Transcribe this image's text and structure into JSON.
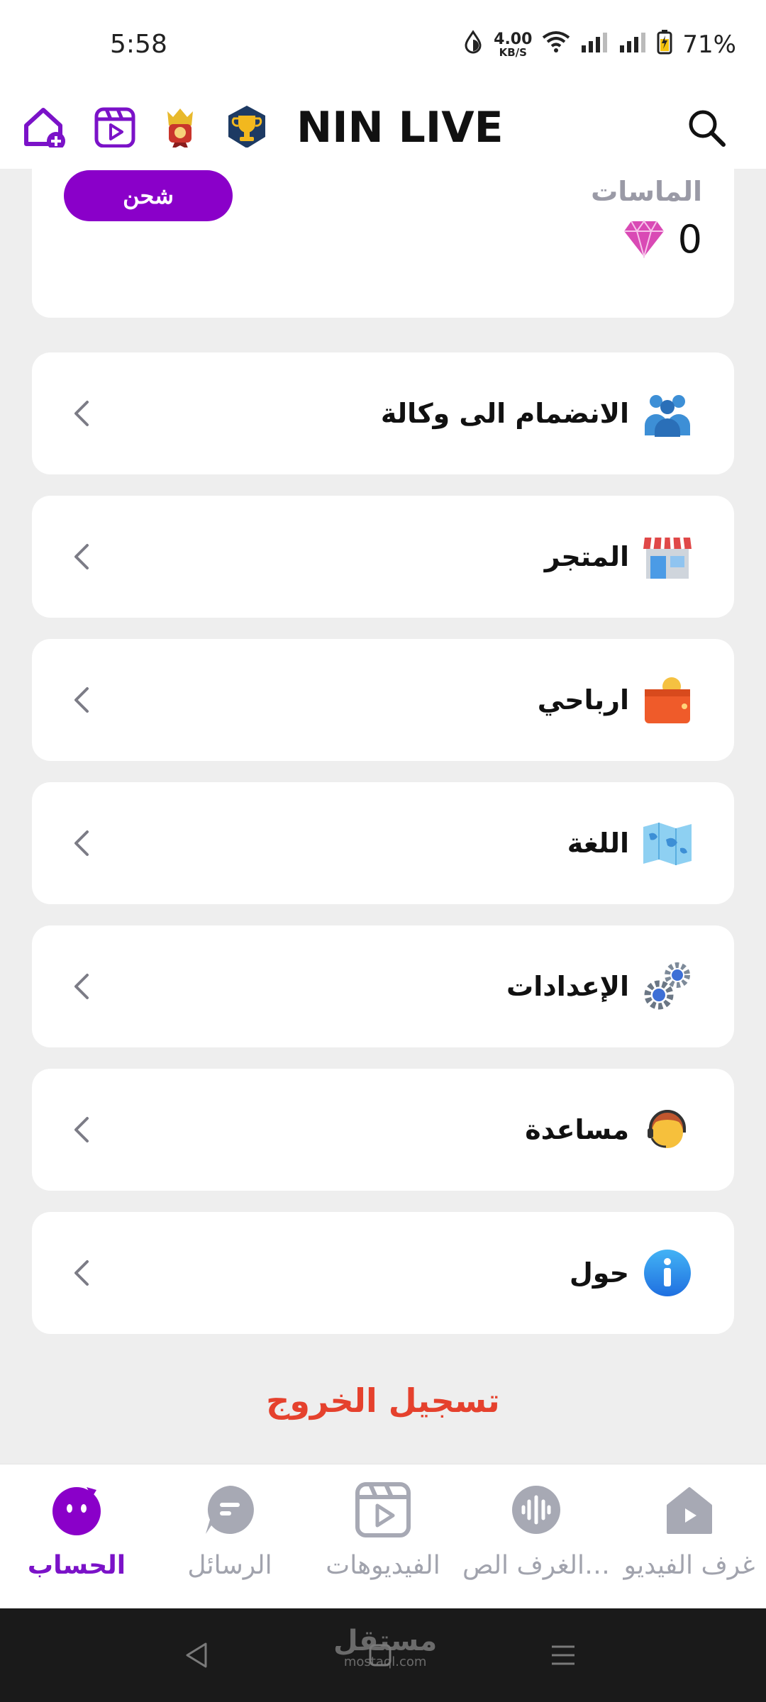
{
  "status_bar": {
    "time": "5:58",
    "net_speed_value": "4.00",
    "net_speed_unit": "KB/S",
    "battery": "71%"
  },
  "header": {
    "title": "NIN LIVE",
    "icons": [
      "home-add-icon",
      "video-reel-icon",
      "king-badge-icon",
      "trophy-icon",
      "search-icon"
    ]
  },
  "diamonds": {
    "label": "الماسات",
    "value": "0",
    "charge_label": "شحن"
  },
  "menu": [
    {
      "label": "الانضمام الى وكالة",
      "icon": "agency-group-icon"
    },
    {
      "label": "المتجر",
      "icon": "store-icon"
    },
    {
      "label": "ارباحي",
      "icon": "wallet-icon"
    },
    {
      "label": "اللغة",
      "icon": "map-icon"
    },
    {
      "label": "الإعدادات",
      "icon": "gears-icon"
    },
    {
      "label": "مساعدة",
      "icon": "support-agent-icon"
    },
    {
      "label": "حول",
      "icon": "info-icon"
    }
  ],
  "logout_label": "تسجيل الخروج",
  "bottom_nav": [
    {
      "label": "الحساب",
      "active": true
    },
    {
      "label": "الرسائل",
      "active": false
    },
    {
      "label": "الفيديوهات",
      "active": false
    },
    {
      "label": "الغرف الص…",
      "active": false
    },
    {
      "label": "غرف الفيديو",
      "active": false
    }
  ],
  "watermark": {
    "line1": "مستقل",
    "line2": "mostaql.com"
  },
  "colors": {
    "accent": "#8a00c9",
    "logout": "#e5412d",
    "background": "#eeeeee",
    "nav_inactive": "#a1a3ad"
  }
}
